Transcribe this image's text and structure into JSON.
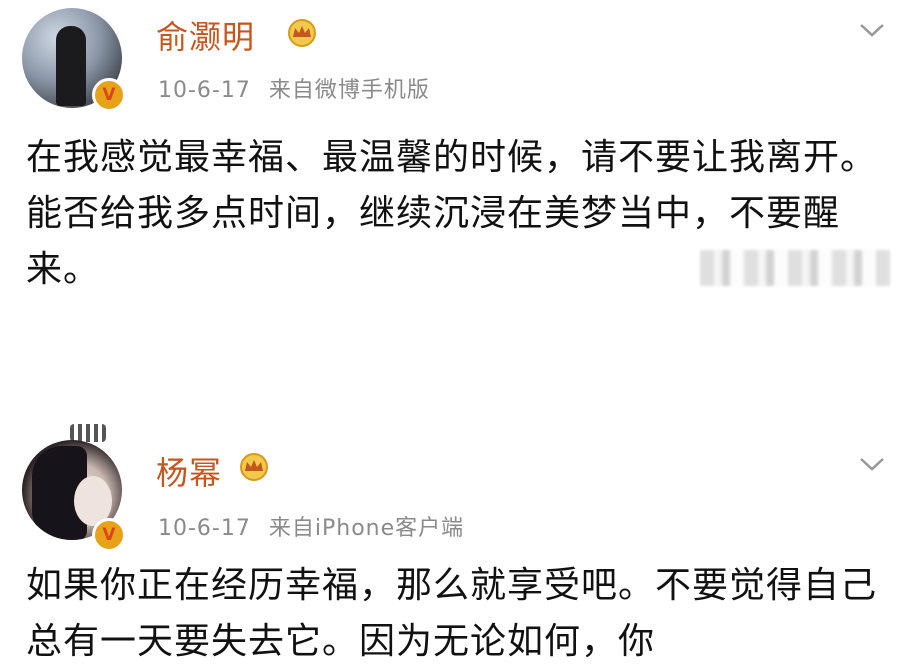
{
  "posts": [
    {
      "author": "俞灏明",
      "date": "10-6-17",
      "source": "来自微博手机版",
      "text": "在我感觉最幸福、最温馨的时候，请不要让我离开。能否给我多点时间，继续沉浸在美梦当中，不要醒来。",
      "verified_icon": "verified-v-badge",
      "vip_icon": "crown-icon"
    },
    {
      "author": "杨幂",
      "date": "10-6-17",
      "source": "来自iPhone客户端",
      "text": "如果你正在经历幸福，那么就享受吧。不要觉得自己总有一天要失去它。因为无论如何，你",
      "verified_icon": "verified-v-badge",
      "vip_icon": "crown-icon"
    }
  ],
  "badge_letter": "V",
  "colors": {
    "name": "#c4561e",
    "meta": "#8a8a8a",
    "badge": "#e8a21a"
  }
}
